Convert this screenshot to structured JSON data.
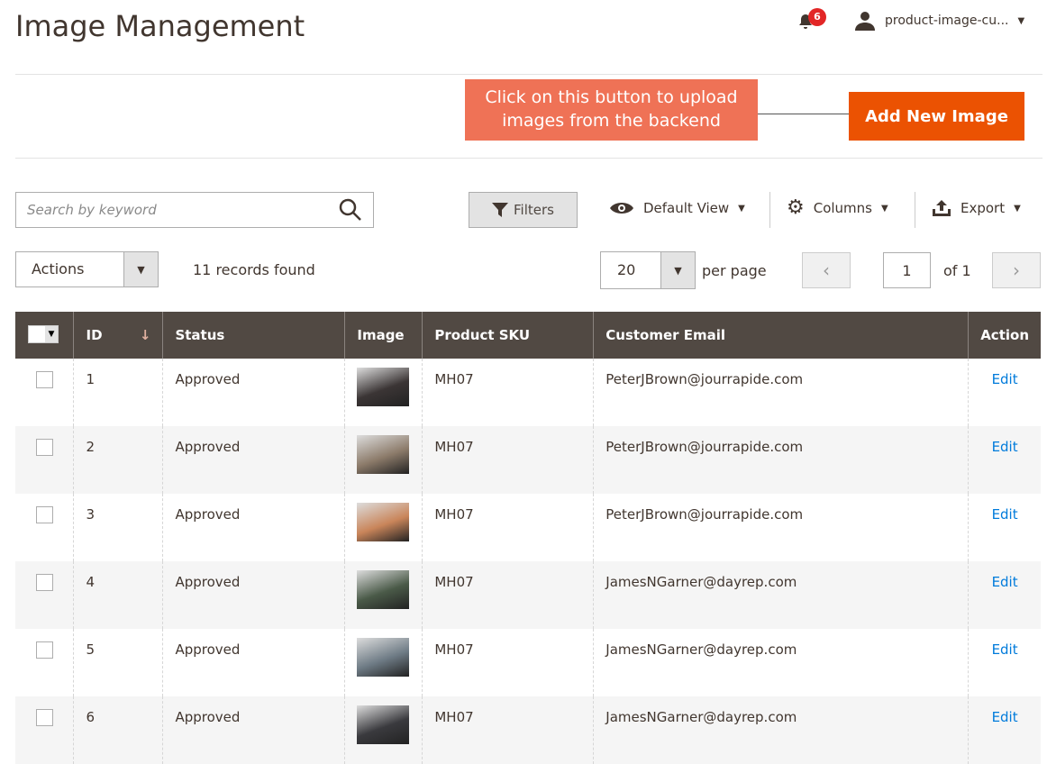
{
  "header": {
    "title": "Image Management",
    "notifications": "6",
    "user": "product-image-cu..."
  },
  "callout": {
    "text": "Click on this button to upload images from the backend"
  },
  "add_button": "Add New Image",
  "toolbar": {
    "search_placeholder": "Search by keyword",
    "filters": "Filters",
    "view": "Default View",
    "columns": "Columns",
    "export": "Export"
  },
  "actions": "Actions",
  "records": "11 records found",
  "pager": {
    "per_page_value": "20",
    "per_page_label": "per page",
    "page": "1",
    "of": "of 1"
  },
  "columns": [
    "ID",
    "Status",
    "Image",
    "Product SKU",
    "Customer Email",
    "Action"
  ],
  "rows": [
    {
      "id": "1",
      "status": "Approved",
      "sku": "MH07",
      "email": "PeterJBrown@jourrapide.com",
      "action": "Edit",
      "thumb": "#3b3535"
    },
    {
      "id": "2",
      "status": "Approved",
      "sku": "MH07",
      "email": "PeterJBrown@jourrapide.com",
      "action": "Edit",
      "thumb": "#8c7b6a"
    },
    {
      "id": "3",
      "status": "Approved",
      "sku": "MH07",
      "email": "PeterJBrown@jourrapide.com",
      "action": "Edit",
      "thumb": "#c9855a"
    },
    {
      "id": "4",
      "status": "Approved",
      "sku": "MH07",
      "email": "JamesNGarner@dayrep.com",
      "action": "Edit",
      "thumb": "#4a5a48"
    },
    {
      "id": "5",
      "status": "Approved",
      "sku": "MH07",
      "email": "JamesNGarner@dayrep.com",
      "action": "Edit",
      "thumb": "#6e7b85"
    },
    {
      "id": "6",
      "status": "Approved",
      "sku": "MH07",
      "email": "JamesNGarner@dayrep.com",
      "action": "Edit",
      "thumb": "#3a3a3e"
    }
  ]
}
